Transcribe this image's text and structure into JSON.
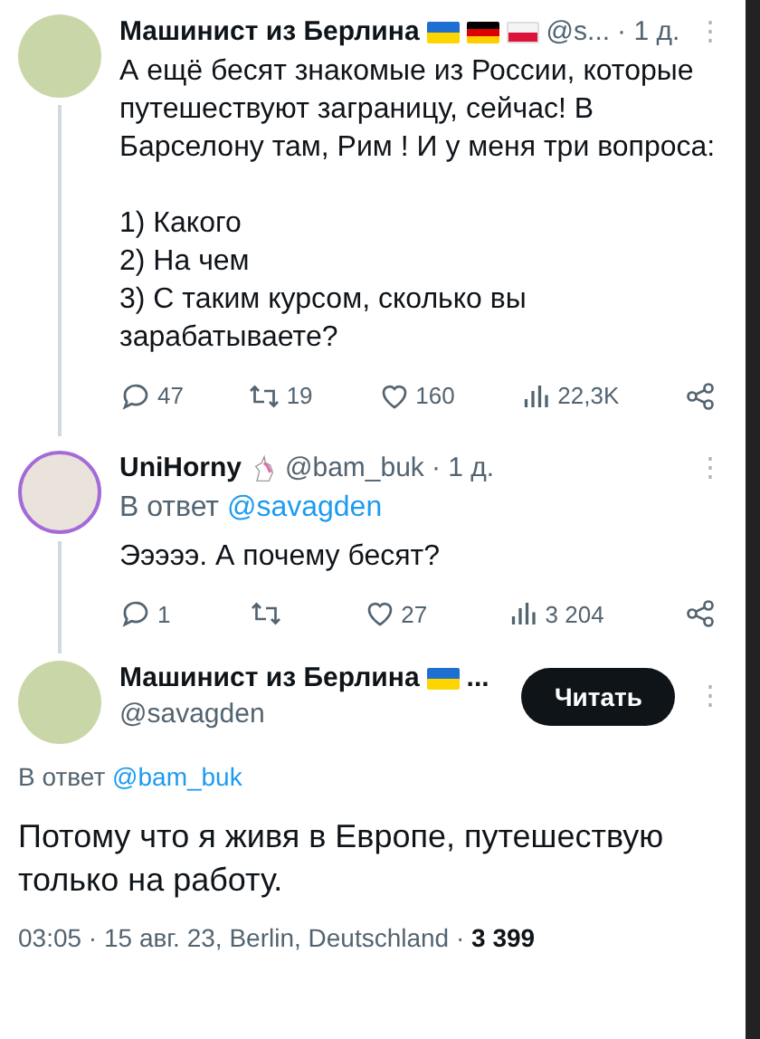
{
  "tweets": [
    {
      "kind": "reply",
      "avatar_ring": false,
      "name": "Машинист из Берлина",
      "badges": [
        {
          "kind": "ua"
        },
        {
          "kind": "de"
        },
        {
          "kind": "pl"
        }
      ],
      "handle": "@s...",
      "time": "· 1 д.",
      "more": "⋮",
      "paragraphs": [
        "А ещё бесят знакомые из России, которые путешествуют заграницу, сейчас! В Барселону там, Рим       ! И у меня три вопроса:",
        "1) Какого\n2) На чем\n3) С таким курсом, сколько вы зарабатываете?"
      ],
      "stats": [
        {
          "kind": "reply",
          "count": "47"
        },
        {
          "kind": "retweet",
          "count": "19"
        },
        {
          "kind": "like",
          "count": "160"
        },
        {
          "kind": "views",
          "count": "22,3K"
        },
        {
          "kind": "share"
        }
      ]
    },
    {
      "kind": "reply",
      "avatar_ring": true,
      "name": "UniHorny",
      "badges": [
        {
          "kind": "unicorn"
        }
      ],
      "handle": "@bam_buk",
      "time": "· 1 д.",
      "more": "⋮",
      "reply_to": {
        "prefix": "В ответ",
        "handle": "@savagden"
      },
      "paragraphs": [
        "Эээээ. А почему бесят?"
      ],
      "stats": [
        {
          "kind": "reply",
          "count": "1"
        },
        {
          "kind": "retweet"
        },
        {
          "kind": "like",
          "count": "27"
        },
        {
          "kind": "views",
          "count": "3 204"
        },
        {
          "kind": "share"
        }
      ]
    },
    {
      "kind": "main",
      "avatar_ring": false,
      "name": "Машинист из Берлина",
      "badges": [
        {
          "kind": "ua"
        }
      ],
      "name_suffix": "...",
      "handle": "@savagden",
      "follow": "Читать",
      "more": "⋮",
      "reply_to": {
        "prefix": "В ответ",
        "handle": "@bam_buk"
      },
      "paragraphs": [
        "Потому что я живя в Европе, путешествую только на работу."
      ],
      "meta": {
        "text": "03:05 · 15 авг. 23, Berlin, Deutschland ·",
        "views": "3 399"
      }
    }
  ]
}
